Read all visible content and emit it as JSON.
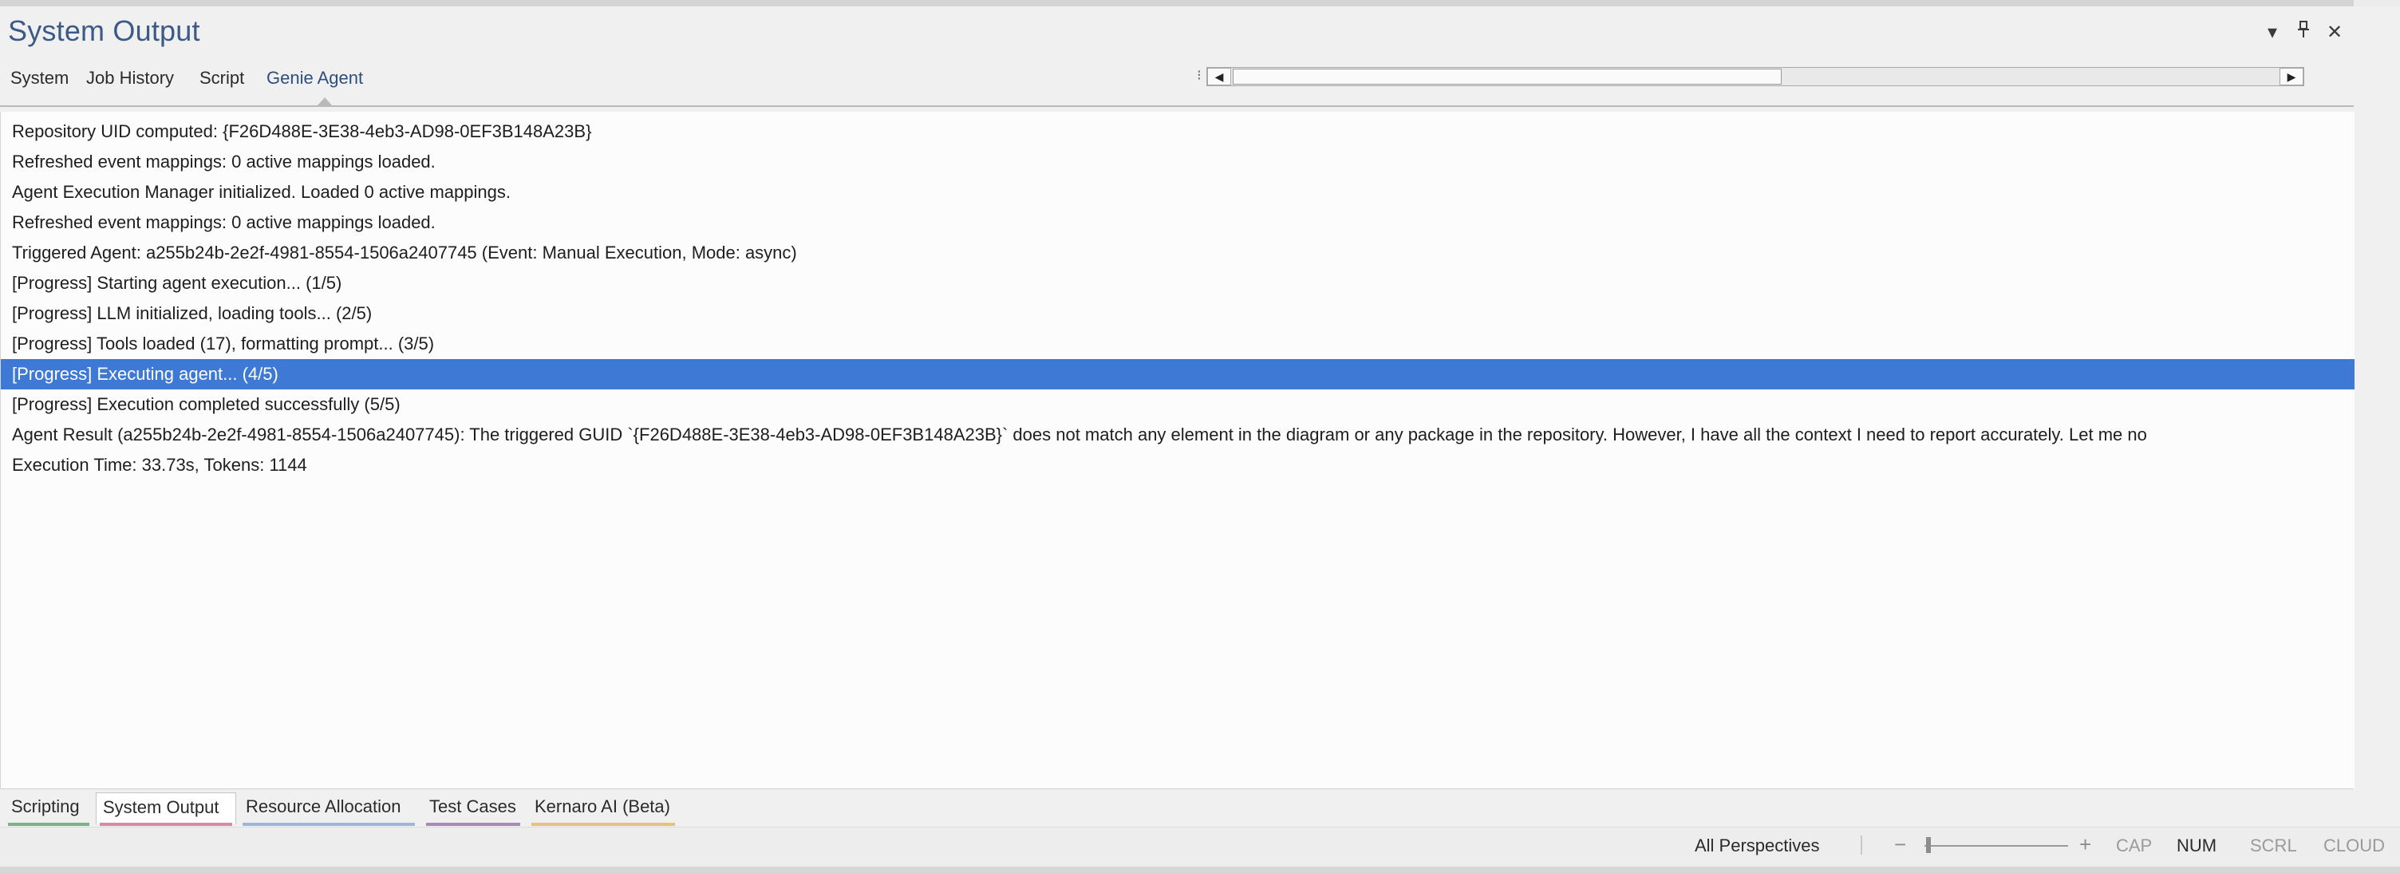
{
  "panel": {
    "title": "System Output",
    "controls": {
      "dropdown_icon": "▾",
      "pin_icon": "📌",
      "close_icon": "✕"
    }
  },
  "subtabs": [
    {
      "label": "System"
    },
    {
      "label": "Job History"
    },
    {
      "label": "Script"
    },
    {
      "label": "Genie Agent",
      "active": true
    }
  ],
  "scrollbar": {
    "left_arrow": "◀",
    "right_arrow": "▶",
    "grip": "⁝"
  },
  "output_lines": [
    "Repository UID computed: {F26D488E-3E38-4eb3-AD98-0EF3B148A23B}",
    "Refreshed event mappings: 0 active mappings loaded.",
    "Agent Execution Manager initialized. Loaded 0 active mappings.",
    "Refreshed event mappings: 0 active mappings loaded.",
    "Triggered Agent: a255b24b-2e2f-4981-8554-1506a2407745 (Event: Manual Execution, Mode: async)",
    "[Progress] Starting agent execution... (1/5)",
    "[Progress] LLM initialized, loading tools... (2/5)",
    "[Progress] Tools loaded (17), formatting prompt... (3/5)",
    "[Progress] Executing agent... (4/5)",
    "[Progress] Execution completed successfully (5/5)",
    "Agent Result (a255b24b-2e2f-4981-8554-1506a2407745): The triggered GUID `{F26D488E-3E38-4eb3-AD98-0EF3B148A23B}` does not match any element in the diagram or any package in the repository. However, I have all the context I need to report accurately. Let me no",
    "Execution Time: 33.73s, Tokens: 1144"
  ],
  "selected_line_index": 8,
  "bottom_tabs": [
    {
      "label": "Scripting",
      "color": "#7fb08a"
    },
    {
      "label": "System Output",
      "color": "#d98aa0",
      "active": true
    },
    {
      "label": "Resource Allocation",
      "color": "#9fb6d6"
    },
    {
      "label": "Test Cases",
      "color": "#a78bb5"
    },
    {
      "label": "Kernaro AI (Beta)",
      "color": "#e2c47a"
    }
  ],
  "statusbar": {
    "perspective": "All Perspectives",
    "zoom_out": "−",
    "zoom_in": "+",
    "cap": "CAP",
    "num": "NUM",
    "scrl": "SCRL",
    "cloud": "CLOUD"
  },
  "colors": {
    "selection": "#3e79d5",
    "title": "#3b5a86"
  }
}
